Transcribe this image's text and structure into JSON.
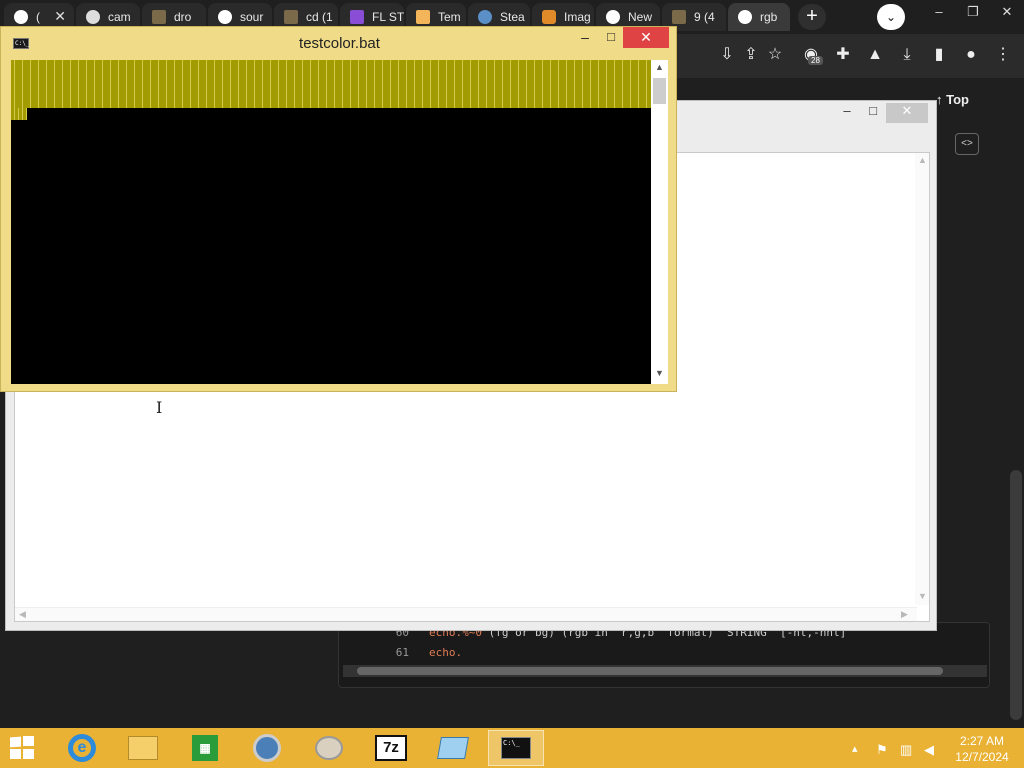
{
  "browser": {
    "tabs": [
      {
        "label": "(",
        "color": "#ffffff"
      },
      {
        "label": "cam",
        "color": "#ffffff"
      },
      {
        "label": "dro",
        "color": "#7a6a4a"
      },
      {
        "label": "sour",
        "color": "#ffffff"
      },
      {
        "label": "cd (1",
        "color": "#7a6a4a"
      },
      {
        "label": "FL ST",
        "color": "#8a4dd6"
      },
      {
        "label": "Tem",
        "color": "#f3b45a"
      },
      {
        "label": "Stea",
        "color": "#5a8fc7"
      },
      {
        "label": "Imag",
        "color": "#e08a2a"
      },
      {
        "label": "New",
        "color": "#ffffff"
      },
      {
        "label": "9 (4",
        "color": "#7a6a4a"
      },
      {
        "label": "rgb",
        "color": "#ffffff"
      }
    ],
    "new_tab": "+",
    "tab_search": "⌄",
    "window_buttons": [
      "–",
      "❐",
      "✕"
    ],
    "extension_badge": "28",
    "top_link": "↑ Top",
    "code_toggle": "<>"
  },
  "code": {
    "lines": [
      {
        "num": "60",
        "kw": "echo.%~0",
        "rest": " (fg or bg) (rgb in \"r,g,b\" format) \"STRING\" [-nl,-nnl]"
      },
      {
        "num": "61",
        "kw": "echo.",
        "rest": ""
      }
    ]
  },
  "console": {
    "title": "testcolor.bat",
    "icon": "C:\\_",
    "min": "–",
    "max": "□",
    "close": "✕",
    "scroll_up": "▲",
    "scroll_down": "▼"
  },
  "dialog": {
    "min": "–",
    "max": "□",
    "close": "✕"
  },
  "taskbar": {
    "apps": [
      "ie-icon",
      "file-explorer-icon",
      "office-icon",
      "chrome-icon",
      "paint-icon",
      "7zip-icon",
      "remote-icon",
      "cmd-icon"
    ],
    "seven_zip": "7z",
    "cmd_label": "C:\\_",
    "time": "2:27 AM",
    "date": "12/7/2024",
    "tray_arrow": "▴"
  }
}
